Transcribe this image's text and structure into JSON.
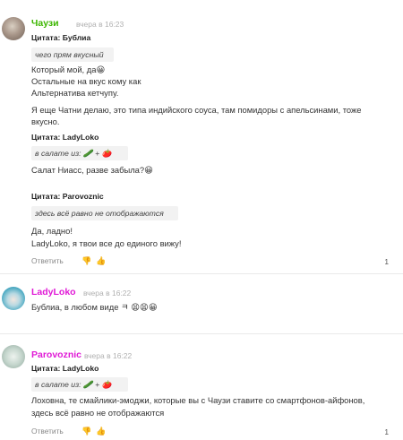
{
  "comments": [
    {
      "user": "Чаузи",
      "time": "вчера в 16:23",
      "quote1_header": "Цитата: Бублиа",
      "quote1_text": "чего прям вкусный",
      "body_lines": [
        "Который мой, да😀",
        "Остальные на вкус кому как",
        "Альтернатива кетчупу.",
        "Я еще Чатни делаю, это типа индийского соуса, там помидоры с апельсинами, тоже",
        "вкусно."
      ],
      "quote2_header": "Цитата: LadyLoko",
      "quote2_text": "в салате из: 🥒 + 🍅",
      "body2": "Салат Ниасс, разве забыла?😀",
      "quote3_header": "Цитата: Parovoznic",
      "quote3_text": "здесь всё равно не отображаются",
      "body3_lines": [
        "Да, ладно!",
        "LadyLoko, я твои все до единого вижу!"
      ],
      "reply": "Ответить",
      "thumb_down": "👎",
      "thumb_up": "👍",
      "votes": "1"
    },
    {
      "user": "LadyLoko",
      "time": "вчера в 16:22",
      "body": "Бублиа, в любом виде ㅋ 😫😫😀"
    },
    {
      "user": "Parovoznic",
      "time": "вчера в 16:22",
      "quote_header": "Цитата: LadyLoko",
      "quote_text": "в салате из: 🥒 + 🍅",
      "body_lines": [
        "Лоховна, те смайлики-эмоджи, которые вы с Чаузи ставите со смартфонов-айфонов,",
        "здесь всё равно не отображаются"
      ],
      "reply": "Ответить",
      "thumb_down": "👎",
      "thumb_up": "👍",
      "votes": "1"
    }
  ],
  "colors": {
    "username_green": "#3cb600",
    "username_pink": "#e01ad6",
    "quote_bg": "#f2f2f2"
  }
}
